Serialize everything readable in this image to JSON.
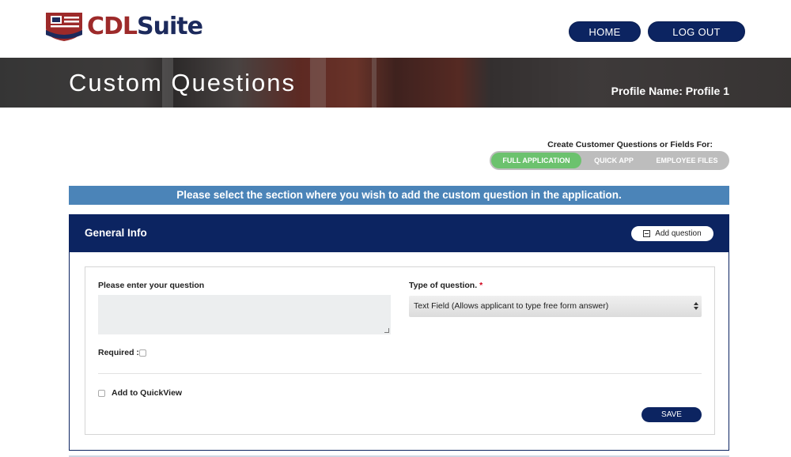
{
  "brand": {
    "part1": "CDL",
    "part2": "Suite",
    "logo_icon": "flag-icon"
  },
  "nav": {
    "home": "HOME",
    "logout": "LOG OUT"
  },
  "banner": {
    "title": "Custom Questions",
    "profile_name": "Profile Name: Profile 1"
  },
  "selector": {
    "label": "Create Customer Questions or Fields For:",
    "options": [
      "FULL APPLICATION",
      "QUICK APP",
      "EMPLOYEE FILES"
    ],
    "active": "FULL APPLICATION"
  },
  "info_strip": "Please select the section where you wish to add the custom question in the application.",
  "section": {
    "title": "General Info",
    "add_question": "Add question",
    "question_label": "Please enter your question",
    "question_value": "",
    "type_label": "Type of question.",
    "required_star": "*",
    "type_value": "Text Field (Allows applicant to type free form answer)",
    "required_label": "Required :",
    "quickview_label": "Add to QuickView",
    "save": "SAVE"
  },
  "colors": {
    "navy": "#0c2461",
    "strip_blue": "#4b84b8",
    "active_green": "#6cc26e",
    "brand_red": "#9d2a2a"
  }
}
